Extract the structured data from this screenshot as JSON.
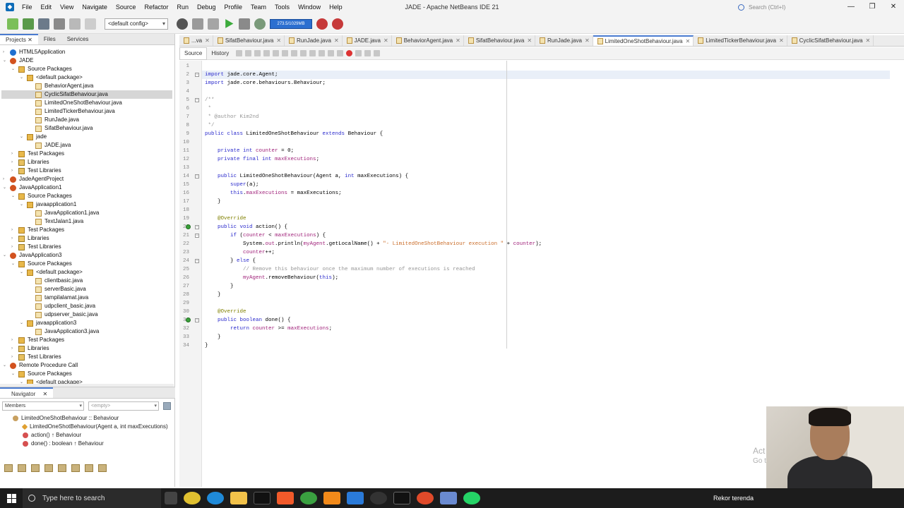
{
  "window": {
    "title": "JADE - Apache NetBeans IDE 21",
    "search_placeholder": "Search (Ctrl+I)"
  },
  "menu": [
    "File",
    "Edit",
    "View",
    "Navigate",
    "Source",
    "Refactor",
    "Run",
    "Debug",
    "Profile",
    "Team",
    "Tools",
    "Window",
    "Help"
  ],
  "toolbar": {
    "config": "<default config>",
    "perf": "273.5/1029MB"
  },
  "left_tabs": [
    "Projects",
    "Files",
    "Services"
  ],
  "tree": [
    {
      "label": "HTML5Application",
      "icon": "html5-project-icon",
      "indent": 0,
      "tw": "›"
    },
    {
      "label": "JADE",
      "icon": "java-project-icon",
      "indent": 0,
      "tw": "⌄"
    },
    {
      "label": "Source Packages",
      "icon": "package-folder-icon",
      "indent": 1,
      "tw": "⌄"
    },
    {
      "label": "<default package>",
      "icon": "package-icon",
      "indent": 2,
      "tw": "⌄"
    },
    {
      "label": "BehaviorAgent.java",
      "icon": "java-file-icon",
      "indent": 3,
      "tw": ""
    },
    {
      "label": "CyclicSifatBehaviour.java",
      "icon": "java-file-icon",
      "indent": 3,
      "tw": "",
      "sel": true
    },
    {
      "label": "LimitedOneShotBehaviour.java",
      "icon": "java-file-icon",
      "indent": 3,
      "tw": ""
    },
    {
      "label": "LimitedTickerBehaviour.java",
      "icon": "java-file-icon",
      "indent": 3,
      "tw": ""
    },
    {
      "label": "RunJade.java",
      "icon": "java-file-icon",
      "indent": 3,
      "tw": ""
    },
    {
      "label": "SifatBehaviour.java",
      "icon": "java-file-icon",
      "indent": 3,
      "tw": ""
    },
    {
      "label": "jade",
      "icon": "package-icon",
      "indent": 2,
      "tw": "⌄"
    },
    {
      "label": "JADE.java",
      "icon": "java-file-icon",
      "indent": 3,
      "tw": ""
    },
    {
      "label": "Test Packages",
      "icon": "package-folder-icon",
      "indent": 1,
      "tw": "›"
    },
    {
      "label": "Libraries",
      "icon": "library-icon",
      "indent": 1,
      "tw": "›"
    },
    {
      "label": "Test Libraries",
      "icon": "library-icon",
      "indent": 1,
      "tw": "›"
    },
    {
      "label": "JadeAgentProject",
      "icon": "java-project-icon",
      "indent": 0,
      "tw": "›"
    },
    {
      "label": "JavaApplication1",
      "icon": "java-project-icon",
      "indent": 0,
      "tw": "⌄"
    },
    {
      "label": "Source Packages",
      "icon": "package-folder-icon",
      "indent": 1,
      "tw": "⌄"
    },
    {
      "label": "javaapplication1",
      "icon": "package-icon",
      "indent": 2,
      "tw": "⌄"
    },
    {
      "label": "JavaApplication1.java",
      "icon": "java-file-icon",
      "indent": 3,
      "tw": ""
    },
    {
      "label": "TextJalan1.java",
      "icon": "java-file-icon",
      "indent": 3,
      "tw": ""
    },
    {
      "label": "Test Packages",
      "icon": "package-folder-icon",
      "indent": 1,
      "tw": "›"
    },
    {
      "label": "Libraries",
      "icon": "library-icon",
      "indent": 1,
      "tw": "›"
    },
    {
      "label": "Test Libraries",
      "icon": "library-icon",
      "indent": 1,
      "tw": "›"
    },
    {
      "label": "JavaApplication3",
      "icon": "java-project-icon",
      "indent": 0,
      "tw": "⌄"
    },
    {
      "label": "Source Packages",
      "icon": "package-folder-icon",
      "indent": 1,
      "tw": "⌄"
    },
    {
      "label": "<default package>",
      "icon": "package-icon",
      "indent": 2,
      "tw": "⌄"
    },
    {
      "label": "clientbasic.java",
      "icon": "java-file-icon",
      "indent": 3,
      "tw": ""
    },
    {
      "label": "serverBasic.java",
      "icon": "java-file-icon",
      "indent": 3,
      "tw": ""
    },
    {
      "label": "tampilalamat.java",
      "icon": "java-file-icon",
      "indent": 3,
      "tw": ""
    },
    {
      "label": "udpclient_basic.java",
      "icon": "java-file-icon",
      "indent": 3,
      "tw": ""
    },
    {
      "label": "udpserver_basic.java",
      "icon": "java-file-icon",
      "indent": 3,
      "tw": ""
    },
    {
      "label": "javaapplication3",
      "icon": "package-icon",
      "indent": 2,
      "tw": "⌄"
    },
    {
      "label": "JavaApplication3.java",
      "icon": "java-file-icon",
      "indent": 3,
      "tw": ""
    },
    {
      "label": "Test Packages",
      "icon": "package-folder-icon",
      "indent": 1,
      "tw": "›"
    },
    {
      "label": "Libraries",
      "icon": "library-icon",
      "indent": 1,
      "tw": "›"
    },
    {
      "label": "Test Libraries",
      "icon": "library-icon",
      "indent": 1,
      "tw": "›"
    },
    {
      "label": "Remote Procedure Call",
      "icon": "java-project-icon",
      "indent": 0,
      "tw": "⌄"
    },
    {
      "label": "Source Packages",
      "icon": "package-folder-icon",
      "indent": 1,
      "tw": "⌄"
    },
    {
      "label": "<default package>",
      "icon": "package-icon",
      "indent": 2,
      "tw": "⌄"
    }
  ],
  "navigator": {
    "tab": "Navigator",
    "members": "Members",
    "filter": "<empty>",
    "items": [
      {
        "label": "LimitedOneShotBehaviour :: Behaviour",
        "kind": "class-icon",
        "level": 0
      },
      {
        "label": "LimitedOneShotBehaviour(Agent a, int maxExecutions)",
        "kind": "constructor-icon",
        "level": 1
      },
      {
        "label": "action() ↑ Behaviour",
        "kind": "method-icon",
        "level": 1
      },
      {
        "label": "done() : boolean ↑ Behaviour",
        "kind": "method-icon",
        "level": 1
      }
    ]
  },
  "editor_tabs": [
    {
      "label": "...va",
      "act": false
    },
    {
      "label": "SifatBehaviour.java",
      "act": false
    },
    {
      "label": "RunJade.java",
      "act": false
    },
    {
      "label": "JADE.java",
      "act": false
    },
    {
      "label": "BehaviorAgent.java",
      "act": false
    },
    {
      "label": "SifatBehaviour.java",
      "act": false
    },
    {
      "label": "RunJade.java",
      "act": false
    },
    {
      "label": "LimitedOneShotBehaviour.java",
      "act": true
    },
    {
      "label": "LimitedTickerBehaviour.java",
      "act": false
    },
    {
      "label": "CyclicSifatBehaviour.java",
      "act": false
    }
  ],
  "source_tabs": [
    "Source",
    "History"
  ],
  "code": [
    {
      "n": "1",
      "t": ""
    },
    {
      "n": "2",
      "t": "[k]import[/k] jade.core.Agent;",
      "hl": true,
      "fold": "−"
    },
    {
      "n": "3",
      "t": "[k]import[/k] jade.core.behaviours.Behaviour;"
    },
    {
      "n": "4",
      "t": ""
    },
    {
      "n": "5",
      "t": "[c]/**[/c]",
      "fold": "−"
    },
    {
      "n": "6",
      "t": "[c] *[/c]"
    },
    {
      "n": "7",
      "t": "[c] * @author Kim2nd[/c]"
    },
    {
      "n": "8",
      "t": "[c] */[/c]"
    },
    {
      "n": "9",
      "t": "[k]public class[/k] LimitedOneShotBehaviour [k]extends[/k] Behaviour {"
    },
    {
      "n": "10",
      "t": ""
    },
    {
      "n": "11",
      "t": "    [k]private int[/k] [f]counter[/f] = 0;"
    },
    {
      "n": "12",
      "t": "    [k]private final int[/k] [f]maxExecutions[/f];"
    },
    {
      "n": "13",
      "t": ""
    },
    {
      "n": "14",
      "t": "    [k]public[/k] LimitedOneShotBehaviour(Agent a, [k]int[/k] maxExecutions) {",
      "fold": "−"
    },
    {
      "n": "15",
      "t": "        [k]super[/k](a);"
    },
    {
      "n": "16",
      "t": "        [k]this[/k].[f]maxExecutions[/f] = maxExecutions;"
    },
    {
      "n": "17",
      "t": "    }"
    },
    {
      "n": "18",
      "t": ""
    },
    {
      "n": "19",
      "t": "    [a]@Override[/a]"
    },
    {
      "n": "20",
      "t": "    [k]public void[/k] action() {",
      "fold": "−",
      "ov": true
    },
    {
      "n": "21",
      "t": "        [k]if[/k] ([f]counter[/f] < [f]maxExecutions[/f]) {",
      "fold": "−"
    },
    {
      "n": "22",
      "t": "            System.[f]out[/f].println([f]myAgent[/f].getLocalName() + [s]\"- LimitedOneShotBehaviour execution \"[/s] + [f]counter[/f]);"
    },
    {
      "n": "23",
      "t": "            [f]counter[/f]++;"
    },
    {
      "n": "24",
      "t": "        } [k]else[/k] {",
      "fold": "−"
    },
    {
      "n": "25",
      "t": "            [c]// Remove this behaviour once the maximum number of executions is reached[/c]"
    },
    {
      "n": "26",
      "t": "            [f]myAgent[/f].removeBehaviour([k]this[/k]);"
    },
    {
      "n": "27",
      "t": "        }"
    },
    {
      "n": "28",
      "t": "    }"
    },
    {
      "n": "29",
      "t": ""
    },
    {
      "n": "30",
      "t": "    [a]@Override[/a]"
    },
    {
      "n": "31",
      "t": "    [k]public boolean[/k] done() {",
      "fold": "−",
      "ov": true
    },
    {
      "n": "32",
      "t": "        [k]return[/k] [f]counter[/f] >= [f]maxExecutions[/f];"
    },
    {
      "n": "33",
      "t": "    }"
    },
    {
      "n": "34",
      "t": "}"
    }
  ],
  "taskbar": {
    "search": "Type here to search",
    "notice": "Rekor terenda"
  },
  "overlay": {
    "activate1": "Act",
    "activate2": "Go t"
  },
  "colors": {
    "keyword": "#2a2acc",
    "comment": "#969696",
    "field": "#a0227a",
    "string": "#ca6d2a",
    "accent": "#4a7bd0"
  }
}
